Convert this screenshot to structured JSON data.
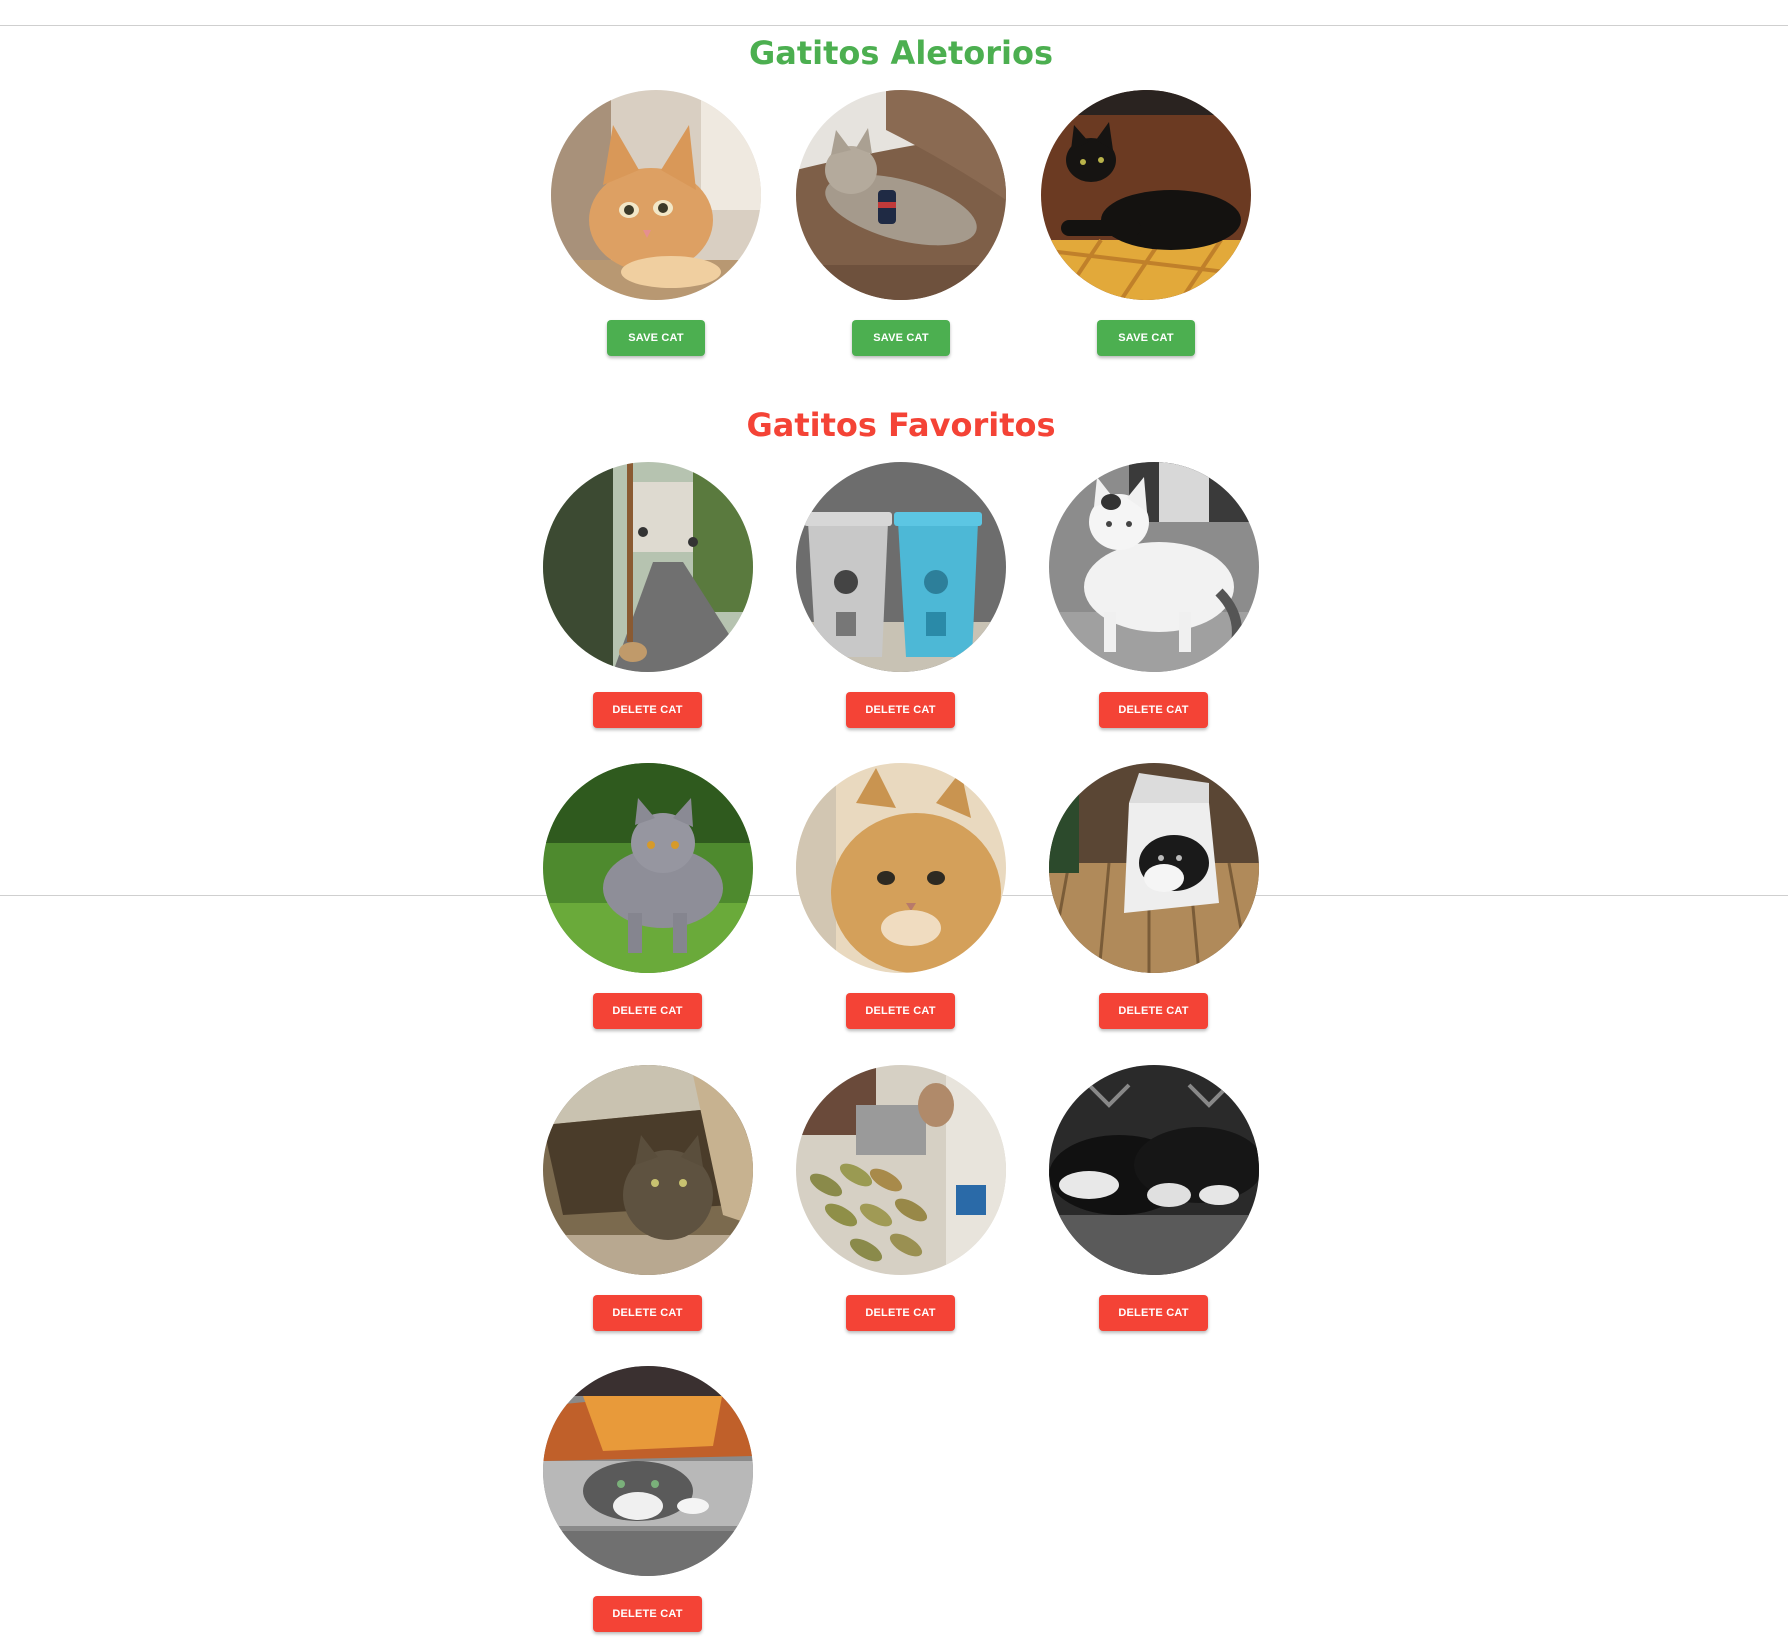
{
  "sections": {
    "random": {
      "title": "Gatitos Aletorios",
      "accent": "#4caf50",
      "cats": [
        {
          "button_label": "SAVE CAT",
          "scene": "orange tabby kitten resting head on paws"
        },
        {
          "button_label": "SAVE CAT",
          "scene": "fluffy grey cat lying on brown sweater"
        },
        {
          "button_label": "SAVE CAT",
          "scene": "black cat lying on floor by brown wall"
        }
      ]
    },
    "favorites": {
      "title": "Gatitos Favoritos",
      "accent": "#f44336",
      "cats": [
        {
          "button_label": "DELETE CAT",
          "scene": "street with trees and small cat by pole"
        },
        {
          "button_label": "DELETE CAT",
          "scene": "grey and blue recycling bins"
        },
        {
          "button_label": "DELETE CAT",
          "scene": "black and white photo of white cat in doorway"
        },
        {
          "button_label": "DELETE CAT",
          "scene": "grey british shorthair cat on grass"
        },
        {
          "button_label": "DELETE CAT",
          "scene": "golden fluffy kitten close-up"
        },
        {
          "button_label": "DELETE CAT",
          "scene": "black and white cat in white crate on wooden deck"
        },
        {
          "button_label": "DELETE CAT",
          "scene": "tabby cat inside cardboard box"
        },
        {
          "button_label": "DELETE CAT",
          "scene": "fish laid out on table with cat watching"
        },
        {
          "button_label": "DELETE CAT",
          "scene": "black and white cats sleeping, monochrome"
        },
        {
          "button_label": "DELETE CAT",
          "scene": "grey and white cat under a box lid"
        }
      ]
    }
  }
}
